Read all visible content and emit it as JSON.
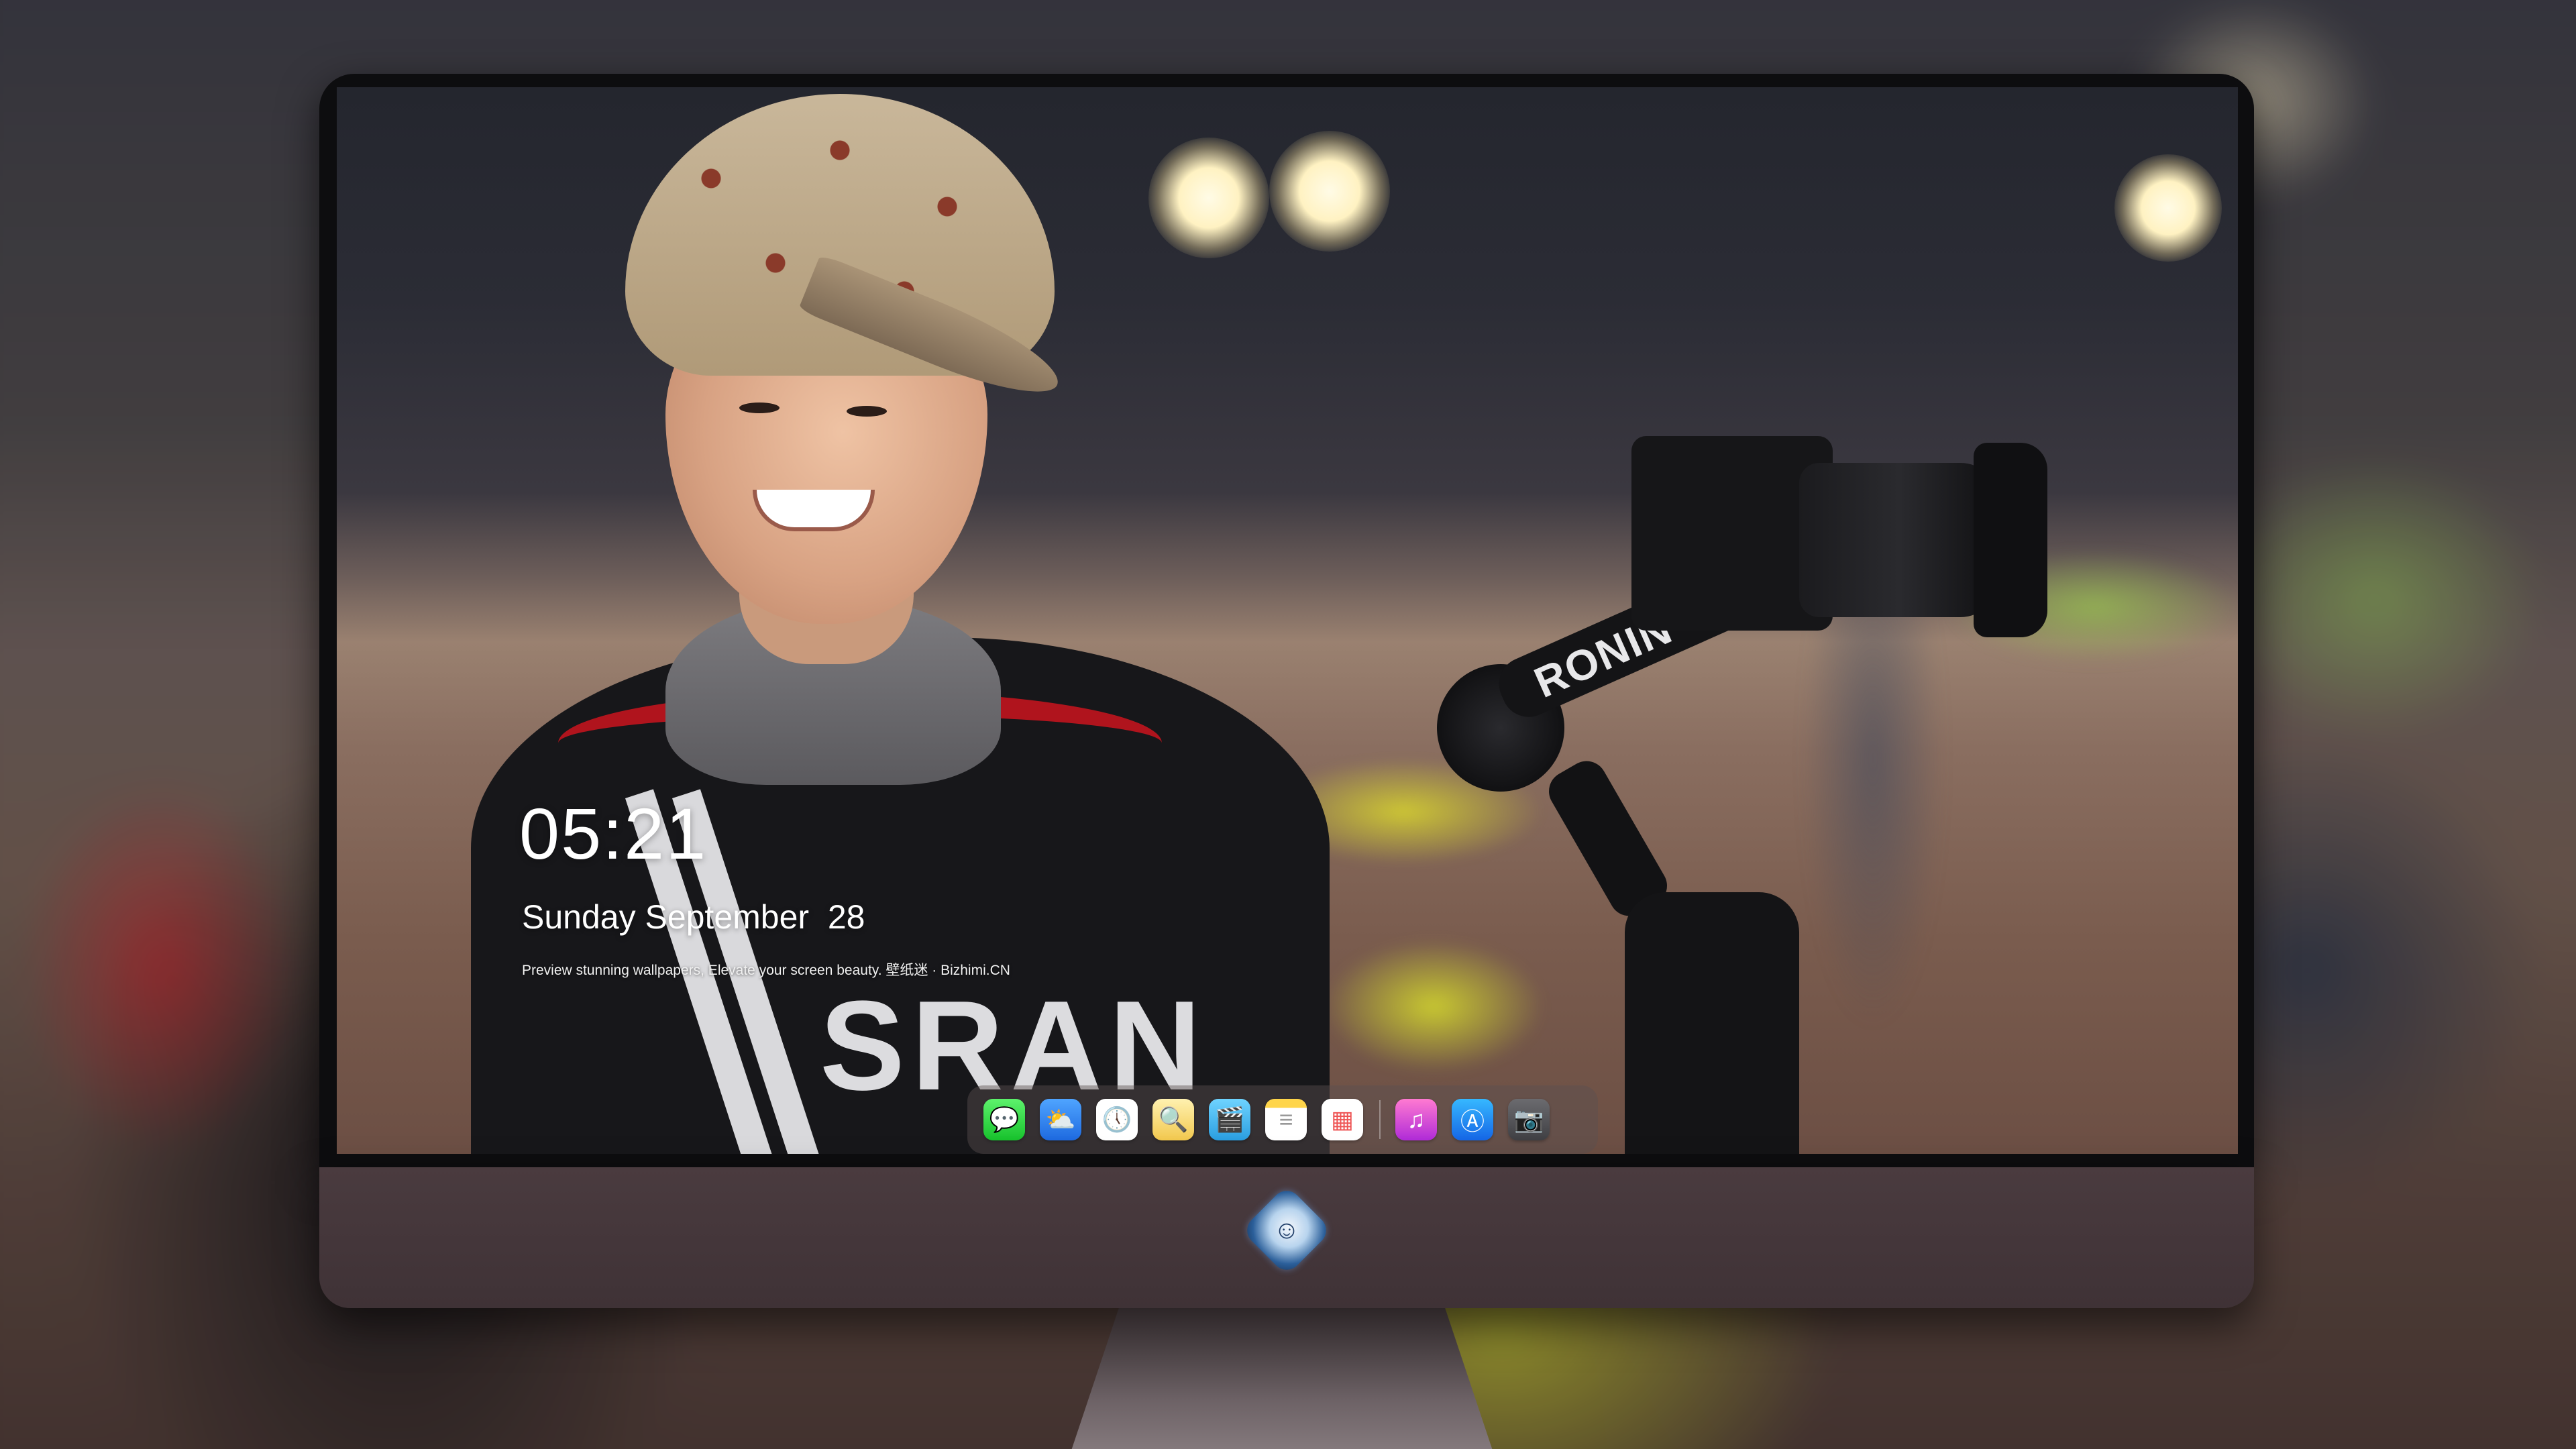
{
  "lockscreen": {
    "time": "05:21",
    "date": "Sunday September  28",
    "caption": "Preview stunning wallpapers, Elevate your screen beauty. 壁纸迷 · Bizhimi.CN"
  },
  "wallpaper": {
    "gimbal_brand": "RONIN",
    "jersey_text": "SRAN"
  },
  "dock": {
    "apps": [
      {
        "name": "Messages",
        "icon": "message-bubble-icon",
        "glyph": "💬"
      },
      {
        "name": "Weather",
        "icon": "cloud-sun-icon",
        "glyph": "⛅"
      },
      {
        "name": "Clock",
        "icon": "clock-icon",
        "glyph": "🕔"
      },
      {
        "name": "Preview",
        "icon": "preview-icon",
        "glyph": "🔍"
      },
      {
        "name": "Clips",
        "icon": "clapperboard-icon",
        "glyph": "🎬"
      },
      {
        "name": "Notes",
        "icon": "notes-icon",
        "glyph": "≡"
      },
      {
        "name": "Photo Booth",
        "icon": "photo-grid-icon",
        "glyph": "▦"
      }
    ],
    "pinned": [
      {
        "name": "Music",
        "icon": "music-note-icon",
        "glyph": "♫"
      },
      {
        "name": "App Store",
        "icon": "app-store-icon",
        "glyph": "Ⓐ"
      },
      {
        "name": "Camera",
        "icon": "camera-icon",
        "glyph": "📷"
      }
    ]
  },
  "colors": {
    "chin": "#4a3b3f",
    "bezel": "#0d0d0f",
    "dock_bg": "rgba(90,80,80,0.45)"
  }
}
